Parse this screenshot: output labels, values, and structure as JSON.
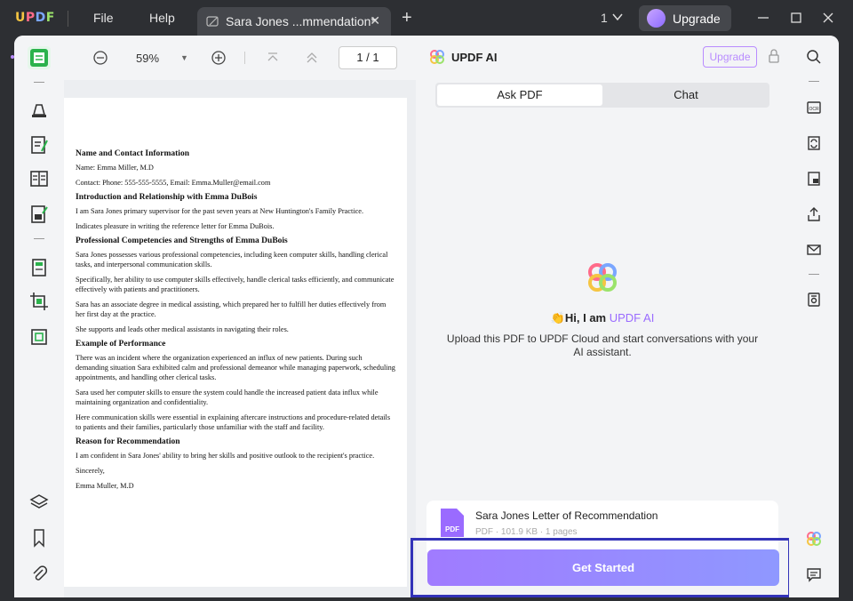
{
  "titlebar": {
    "logo": {
      "u": "U",
      "p": "P",
      "d": "D",
      "f": "F"
    },
    "menu": {
      "file": "File",
      "help": "Help"
    },
    "tab_title": "Sara Jones ...mmendation*",
    "tab_close": "✕",
    "new_tab": "+",
    "window_count": "1",
    "upgrade_label": "Upgrade"
  },
  "doc_toolbar": {
    "zoom": "59%",
    "zoom_dropdown": "▼",
    "page_indicator": "1 / 1"
  },
  "document": {
    "sections": [
      {
        "heading": "Name and Contact Information",
        "paras": [
          "Name: Emma Miller, M.D",
          "Contact: Phone: 555-555-5555, Email: Emma.Muller@email.com"
        ]
      },
      {
        "heading": "Introduction and Relationship with Emma DuBois",
        "paras": [
          "I am Sara Jones primary supervisor for the past seven years at New Huntington's Family Practice.",
          "Indicates pleasure in writing the reference letter for Emma DuBois."
        ]
      },
      {
        "heading": "Professional Competencies and Strengths of Emma DuBois",
        "paras": [
          "Sara Jones possesses various professional competencies, including keen computer skills, handling clerical tasks, and interpersonal communication skills.",
          "Specifically, her ability to use computer skills effectively, handle clerical tasks efficiently, and communicate effectively with patients and practitioners.",
          "Sara has an associate degree in medical assisting, which prepared her to fulfill her duties effectively from her first day at the practice.",
          "She supports and leads other medical assistants in navigating their roles."
        ]
      },
      {
        "heading": "Example of Performance",
        "paras": [
          "There was an incident where the organization experienced an influx of new patients. During such demanding situation Sara exhibited calm and professional demeanor while managing paperwork, scheduling appointments, and handling other clerical tasks.",
          "Sara used her computer skills to ensure the system could handle the increased patient data influx while maintaining organization and confidentiality.",
          "Here communication skills were essential in explaining aftercare instructions and procedure-related details to patients and their families, particularly those unfamiliar with the staff and facility."
        ]
      },
      {
        "heading": "Reason for Recommendation",
        "paras": [
          "I am confident in Sara Jones' ability to bring her skills and positive outlook to the recipient's practice.",
          "Sincerely,",
          "Emma Muller, M.D"
        ]
      }
    ]
  },
  "ai_panel": {
    "title": "UPDF AI",
    "upgrade": "Upgrade",
    "tabs": {
      "ask_pdf": "Ask PDF",
      "chat": "Chat"
    },
    "greeting_prefix": "👏Hi, I am ",
    "greeting_name": "UPDF AI",
    "description": "Upload this PDF to UPDF Cloud and start conversations with your AI assistant.",
    "file": {
      "name": "Sara Jones Letter of Recommendation",
      "meta": "PDF · 101.9 KB · 1 pages",
      "icon_label": "PDF"
    },
    "get_started": "Get Started"
  },
  "colors": {
    "accent_purple": "#9a6bff",
    "highlight_border": "#3333b8",
    "active_green": "#2bb24c"
  }
}
